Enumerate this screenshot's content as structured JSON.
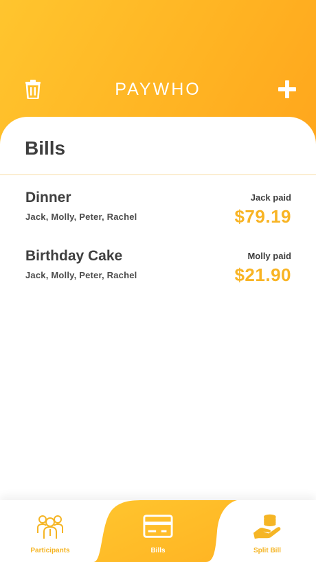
{
  "colors": {
    "accent": "#ffb423",
    "amount": "#f8b425",
    "text_dark": "#3f3f3f"
  },
  "header": {
    "title": "PAYWHO",
    "left_icon": "trash-icon",
    "right_icon": "plus-icon"
  },
  "page": {
    "title": "Bills"
  },
  "bills": [
    {
      "name": "Dinner",
      "participants": "Jack, Molly, Peter, Rachel",
      "payer": "Jack paid",
      "amount": "$79.19"
    },
    {
      "name": "Birthday Cake",
      "participants": "Jack, Molly, Peter, Rachel",
      "payer": "Molly paid",
      "amount": "$21.90"
    }
  ],
  "tabs": [
    {
      "label": "Participants",
      "icon": "people-icon",
      "active": false
    },
    {
      "label": "Bills",
      "icon": "credit-card-icon",
      "active": true
    },
    {
      "label": "Split Bill",
      "icon": "hand-coins-icon",
      "active": false
    }
  ]
}
